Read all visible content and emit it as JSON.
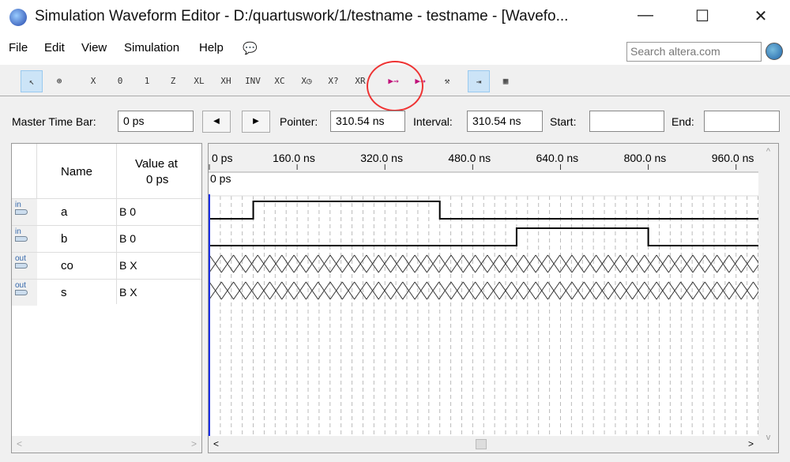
{
  "window": {
    "title": "Simulation Waveform Editor - D:/quartuswork/1/testname - testname - [Wavefo...",
    "minimize": "—",
    "maximize": "☐",
    "close": "✕"
  },
  "menu": {
    "items": [
      "File",
      "Edit",
      "View",
      "Simulation",
      "Help"
    ],
    "search_placeholder": "Search altera.com"
  },
  "toolbar": {
    "tools": [
      "↖",
      "⊕",
      "X",
      "0",
      "1",
      "Z",
      "XL",
      "XH",
      "INV",
      "XC",
      "X◷",
      "X?",
      "XR",
      "▶⇝",
      "▶⇝",
      "⚒",
      "⇥",
      "▦"
    ]
  },
  "timebar": {
    "master_label": "Master Time Bar:",
    "master_value": "0 ps",
    "prev": "◀",
    "next": "▶",
    "pointer_label": "Pointer:",
    "pointer_value": "310.54 ns",
    "interval_label": "Interval:",
    "interval_value": "310.54 ns",
    "start_label": "Start:",
    "start_value": "",
    "end_label": "End:",
    "end_value": ""
  },
  "table": {
    "name_header": "Name",
    "value_header_1": "Value at",
    "value_header_2": "0 ps",
    "signals": [
      {
        "dir": "in",
        "name": "a",
        "value": "B 0"
      },
      {
        "dir": "in",
        "name": "b",
        "value": "B 0"
      },
      {
        "dir": "out",
        "name": "co",
        "value": "B X"
      },
      {
        "dir": "out",
        "name": "s",
        "value": "B X"
      }
    ]
  },
  "waveform": {
    "ruler_labels": [
      "0 ps",
      "160.0 ns",
      "320.0 ns",
      "480.0 ns",
      "640.0 ns",
      "800.0 ns",
      "960.0 ns"
    ],
    "cursor_label": "0 ps",
    "range_ns": [
      0,
      1000
    ],
    "grid_ns": 20,
    "signals": [
      {
        "name": "a",
        "type": "digital",
        "transitions": [
          [
            0,
            0
          ],
          [
            80,
            1
          ],
          [
            420,
            0
          ]
        ]
      },
      {
        "name": "b",
        "type": "digital",
        "transitions": [
          [
            0,
            0
          ],
          [
            560,
            1
          ],
          [
            800,
            0
          ]
        ]
      },
      {
        "name": "co",
        "type": "unknown"
      },
      {
        "name": "s",
        "type": "unknown"
      }
    ]
  }
}
